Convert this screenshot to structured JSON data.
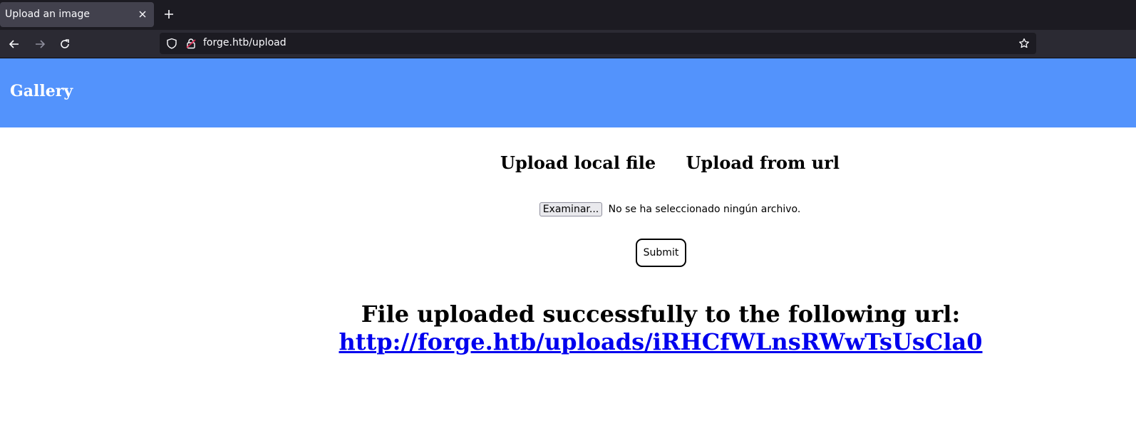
{
  "browser": {
    "tab_title": "Upload an image",
    "url": "forge.htb/upload",
    "icons": {
      "close": "close-icon",
      "new_tab": "plus-icon",
      "back": "arrow-left-icon",
      "forward": "arrow-right-icon",
      "reload": "reload-icon",
      "shield": "shield-icon",
      "lock": "lock-icon",
      "bookmark": "star-icon"
    }
  },
  "header": {
    "brand": "Gallery",
    "background": "#5393fc"
  },
  "upload": {
    "tab_local": "Upload local file",
    "tab_url": "Upload from url",
    "browse_label": "Examinar...",
    "file_status": "No se ha seleccionado ningún archivo.",
    "submit_label": "Submit"
  },
  "result": {
    "message": "File uploaded successfully to the following url:",
    "link": "http://forge.htb/uploads/iRHCfWLnsRWwTsUsCla0",
    "link_color": "#0000ee"
  }
}
